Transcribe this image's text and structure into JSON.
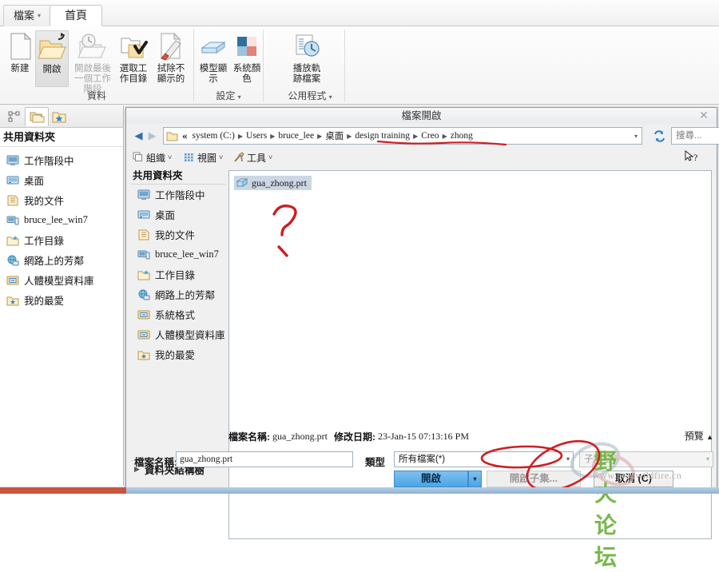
{
  "app": {
    "tabs": [
      {
        "label": "檔案",
        "caret": "▾"
      },
      {
        "label": "首頁"
      }
    ],
    "ribbon_groups": [
      {
        "label": "資料",
        "buttons": [
          {
            "label": "新建",
            "icon": "new-file-icon",
            "state": "normal"
          },
          {
            "label": "開啟",
            "icon": "open-folder-icon",
            "state": "selected"
          },
          {
            "label": "開啟最後一個工作階段",
            "icon": "open-last-session-icon",
            "state": "disabled"
          },
          {
            "label": "選取工作目錄",
            "icon": "select-working-directory-icon",
            "state": "normal"
          },
          {
            "label": "拭除不顯示的",
            "icon": "erase-not-displayed-icon",
            "state": "normal"
          }
        ]
      },
      {
        "label": "設定",
        "caret": "▾",
        "launcher": "◪",
        "buttons": [
          {
            "label": "模型顯示",
            "icon": "model-display-icon",
            "state": "normal"
          },
          {
            "label": "系統顏色",
            "icon": "system-colors-icon",
            "state": "normal"
          }
        ]
      },
      {
        "label": "公用程式",
        "caret": "▾",
        "buttons": [
          {
            "label": "播放軌跡檔案",
            "icon": "play-trail-file-icon",
            "state": "normal"
          }
        ]
      }
    ]
  },
  "navigator": {
    "tabs": [
      {
        "icon": "model-tree-icon",
        "active": false
      },
      {
        "icon": "folder-browser-icon",
        "active": true
      },
      {
        "icon": "favorites-folder-icon",
        "active": false
      }
    ],
    "header": "共用資料夾",
    "items": [
      {
        "label": "工作階段中",
        "icon": "monitor-icon"
      },
      {
        "label": "桌面",
        "icon": "desktop-icon"
      },
      {
        "label": "我的文件",
        "icon": "documents-icon"
      },
      {
        "label": "bruce_lee_win7",
        "icon": "computer-icon"
      },
      {
        "label": "工作目錄",
        "icon": "working-dir-icon"
      },
      {
        "label": "網路上的芳鄰",
        "icon": "network-icon"
      },
      {
        "label": "人體模型資料庫",
        "icon": "manikin-library-icon"
      },
      {
        "label": "我的最愛",
        "icon": "favorites-icon"
      }
    ]
  },
  "dialog": {
    "title": "檔案開啟",
    "close": "✕",
    "back_icon": "back-arrow-icon",
    "forward_icon": "forward-arrow-icon",
    "history_caret": "▾",
    "path": {
      "folder_icon": "folder-icon",
      "overflow": "«",
      "crumbs": [
        "system (C:)",
        "Users",
        "bruce_lee",
        "桌面",
        "design training",
        "Creo",
        "zhong"
      ],
      "separator": "▶",
      "dropdown_caret": "▾",
      "refresh_icon": "refresh-icon"
    },
    "search_placeholder": "搜尋...",
    "toolbar": [
      {
        "label": "組織",
        "icon": "organize-icon",
        "caret": "˅"
      },
      {
        "label": "視圖",
        "icon": "view-icon",
        "caret": "˅"
      },
      {
        "label": "工具",
        "icon": "tools-icon",
        "caret": "˅"
      }
    ],
    "help_cursor_icon": "help-pointer-icon",
    "sidebar": {
      "header": "共用資料夾",
      "items": [
        {
          "label": "工作階段中",
          "icon": "monitor-icon"
        },
        {
          "label": "桌面",
          "icon": "desktop-icon"
        },
        {
          "label": "我的文件",
          "icon": "documents-icon"
        },
        {
          "label": "bruce_lee_win7",
          "icon": "computer-icon"
        },
        {
          "label": "工作目錄",
          "icon": "working-dir-icon"
        },
        {
          "label": "網路上的芳鄰",
          "icon": "network-icon"
        },
        {
          "label": "系統格式",
          "icon": "system-formats-icon"
        },
        {
          "label": "人體模型資料庫",
          "icon": "manikin-library-icon"
        },
        {
          "label": "我的最愛",
          "icon": "favorites-icon"
        }
      ],
      "tree_toggle": {
        "label": "資料夾結構樹",
        "triangle": "▶"
      }
    },
    "files": [
      {
        "name": "gua_zhong.prt",
        "icon": "part-file-icon",
        "selected": true
      }
    ],
    "status": {
      "name_key": "檔案名稱:",
      "name_value": "gua_zhong.prt",
      "date_key": "修改日期:",
      "date_value": "23-Jan-15 07:13:16 PM",
      "preview_label": "預覽",
      "preview_caret": "▲"
    },
    "bottom": {
      "filename_label": "檔案名稱:",
      "filename_value": "gua_zhong.prt",
      "type_label": "類型",
      "type_value": "所有檔案(*)",
      "type_caret": "▾",
      "subtype_value": "子類型",
      "subtype_caret": "▾",
      "open_button": "開啟",
      "open_split_caret": "▾",
      "open_subset_button": "開啟子集...",
      "cancel_button": "取消 (C)"
    }
  },
  "annotations": {
    "question_mark": "hand-drawn red question mark over empty file list",
    "path_underline": "red underline beneath 'design training ▶ Creo ▶ zhong'",
    "type_circle": "red ellipse circling the 所有檔案(*) type selector",
    "open_circle": "red ellipse circling the 開啟 button area"
  },
  "watermark": {
    "text": "野火论坛",
    "url": "www.proewildfire.cn",
    "color": "#79b84c"
  },
  "colors": {
    "accent": "#4ca5e6",
    "annotation_red": "#cc1f24",
    "selection": "#ccd7e4"
  }
}
